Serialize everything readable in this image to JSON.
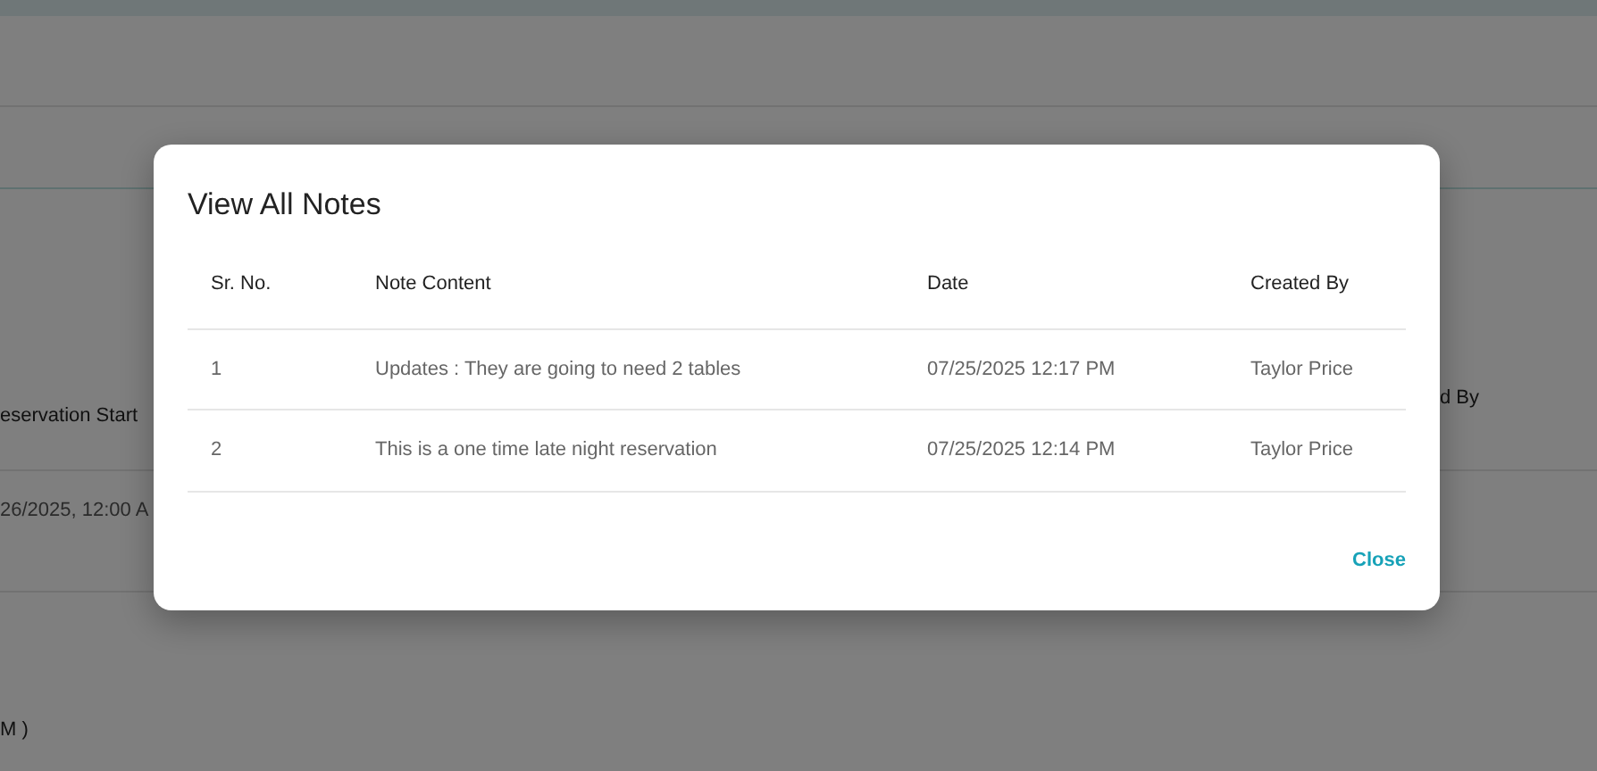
{
  "background": {
    "column_1_heading": "eservation Start",
    "column_2_heading": "d By",
    "cell": "26/2025, 12:00 A",
    "text": "M )"
  },
  "modal": {
    "title": "View All Notes",
    "columns": [
      "Sr. No.",
      "Note Content",
      "Date",
      "Created By"
    ],
    "rows": [
      [
        "1",
        "Updates : They are going to need 2 tables",
        "07/25/2025 12:17 PM",
        "Taylor Price"
      ],
      [
        "2",
        "This is a one time late night reservation",
        "07/25/2025 12:14 PM",
        "Taylor Price"
      ]
    ],
    "close_button": "Close"
  }
}
